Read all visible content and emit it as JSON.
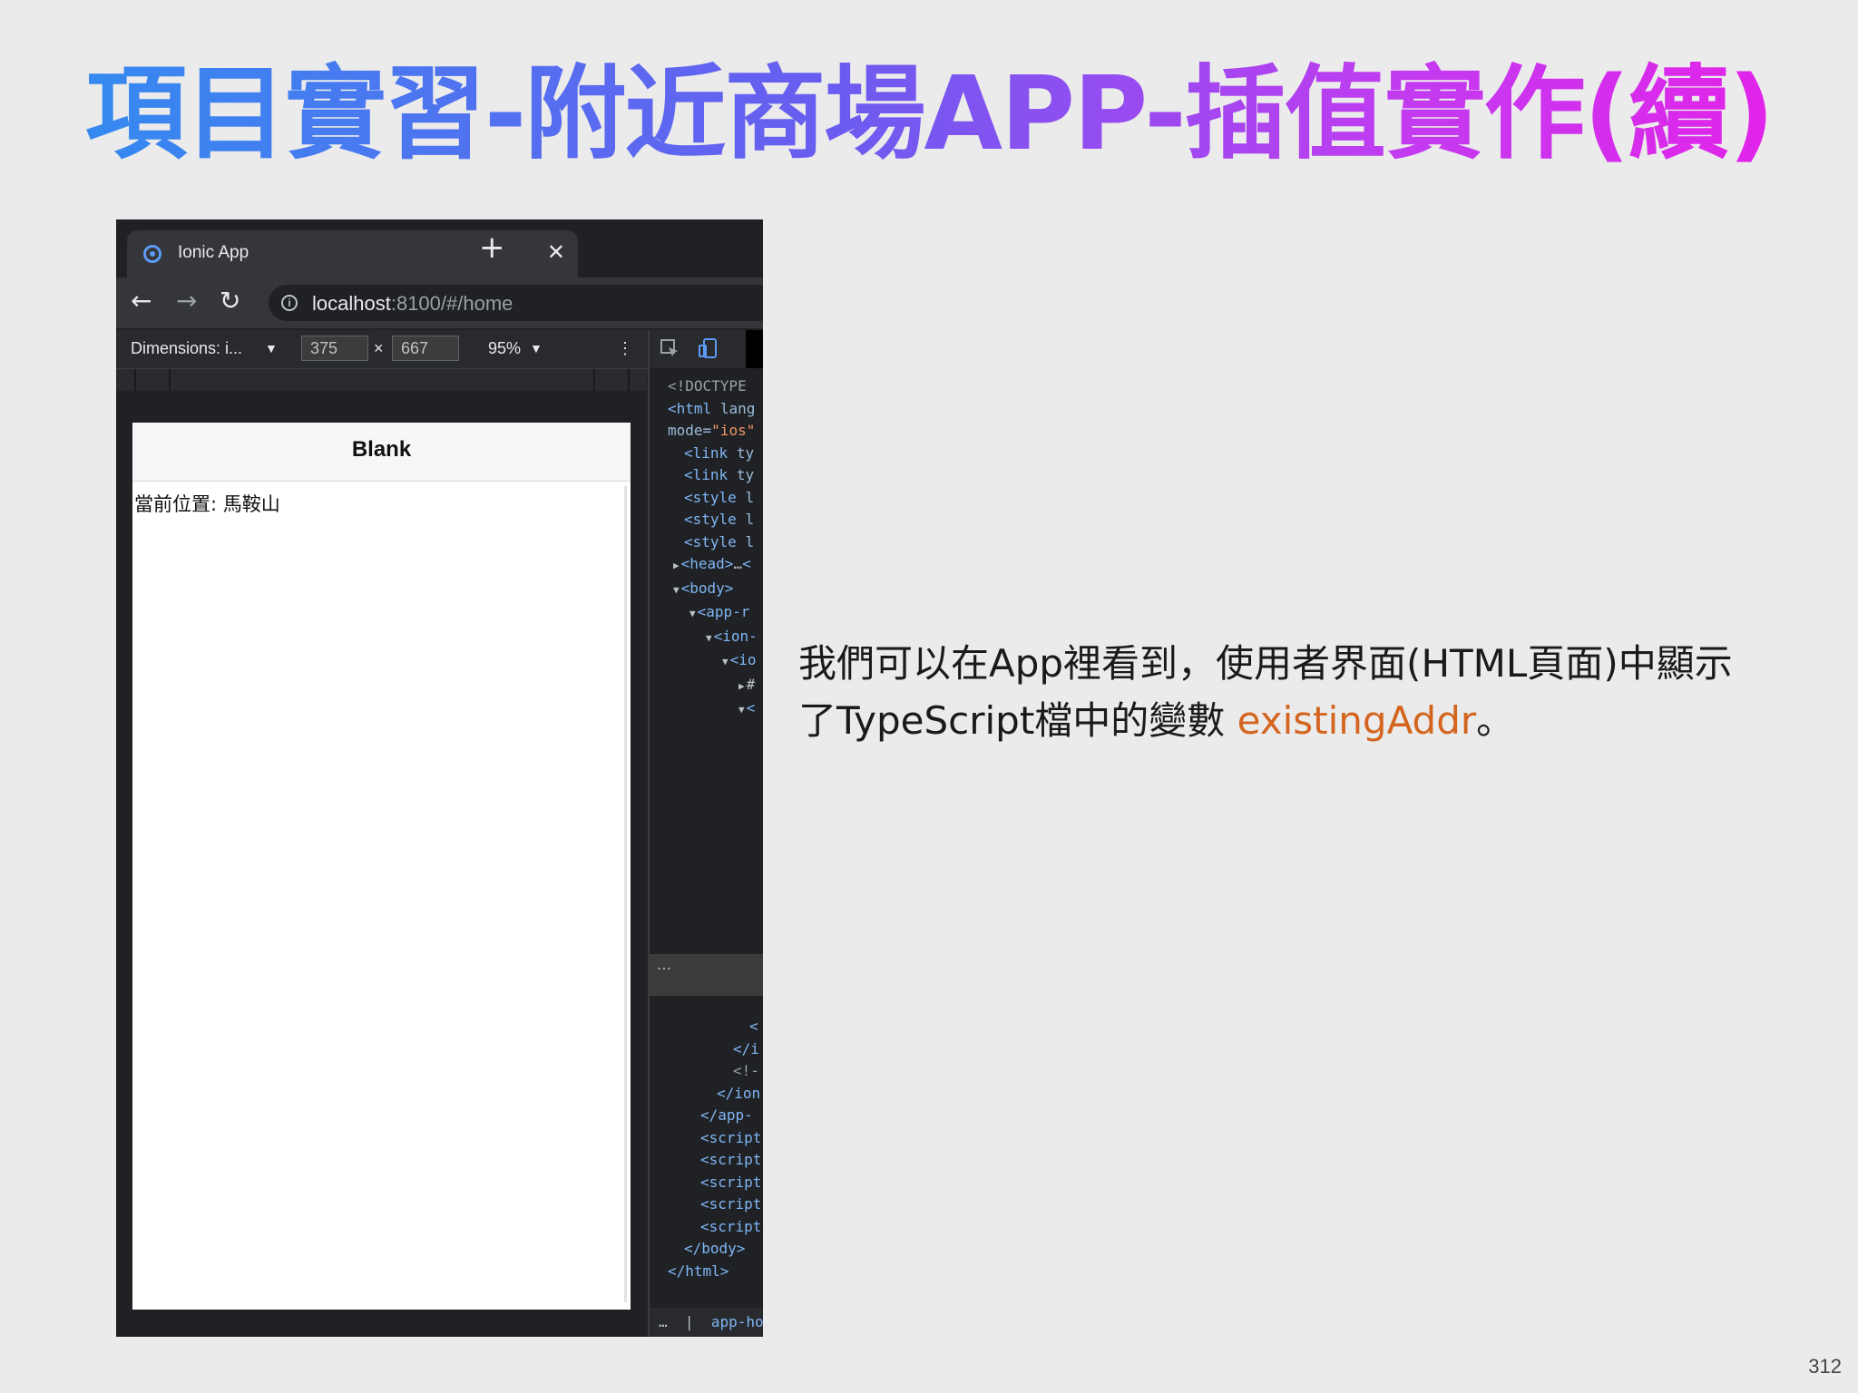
{
  "slide": {
    "title": "項目實習-附近商場APP-插值實作(續)",
    "page_number": "312",
    "caption_before": "我們可以在App裡看到，使用者界面(HTML頁面)中顯示了TypeScript檔中的變數 ",
    "caption_highlight": "existingAddr",
    "caption_after": "。",
    "highlight_color": "#d4651f"
  },
  "browser": {
    "tab_title": "Ionic App",
    "tab_close": "✕",
    "new_tab": "+",
    "url_host": "localhost",
    "url_path": ":8100/#/home",
    "nav": {
      "back": "←",
      "forward": "→",
      "reload": "↻"
    }
  },
  "devbar": {
    "device": "Dimensions: i...",
    "device_arrow": "▼",
    "width": "375",
    "times": "×",
    "height": "667",
    "zoom": "95%",
    "zoom_arrow": "▼",
    "more": "⋮"
  },
  "app": {
    "title": "Blank",
    "content": "當前位置: 馬鞍山"
  },
  "devtools": {
    "lines": [
      {
        "indent": 0,
        "arrow": "",
        "html": "<span class='cmt'>&lt;!DOCTYPE</span>"
      },
      {
        "indent": 0,
        "arrow": "",
        "html": "<span class='tag'>&lt;html</span> <span class='attr'>lang</span>"
      },
      {
        "indent": 0,
        "arrow": "",
        "html": "<span class='attr'>mode=</span><span class='val'>\"ios\"</span>"
      },
      {
        "indent": 1,
        "arrow": "",
        "html": "<span class='tag'>&lt;link</span> <span class='attr'>ty</span>"
      },
      {
        "indent": 1,
        "arrow": "",
        "html": "<span class='tag'>&lt;link</span> <span class='attr'>ty</span>"
      },
      {
        "indent": 1,
        "arrow": "",
        "html": "<span class='tag'>&lt;style</span> <span class='attr'>l</span>"
      },
      {
        "indent": 1,
        "arrow": "",
        "html": "<span class='tag'>&lt;style</span> <span class='attr'>l</span>"
      },
      {
        "indent": 1,
        "arrow": "",
        "html": "<span class='tag'>&lt;style</span> <span class='attr'>l</span>"
      },
      {
        "indent": 1,
        "arrow": "▶",
        "html": "<span class='tag'>&lt;head&gt;</span>…<span class='tag'>&lt;</span>"
      },
      {
        "indent": 1,
        "arrow": "▼",
        "html": "<span class='tag'>&lt;body&gt;</span>"
      },
      {
        "indent": 2,
        "arrow": "▼",
        "html": "<span class='tag'>&lt;app-r</span>"
      },
      {
        "indent": 3,
        "arrow": "▼",
        "html": "<span class='tag'>&lt;ion-</span>"
      },
      {
        "indent": 4,
        "arrow": "▼",
        "html": "<span class='tag'>&lt;io</span>"
      },
      {
        "indent": 5,
        "arrow": "▶",
        "html": "#"
      },
      {
        "indent": 5,
        "arrow": "▼",
        "html": "<span class='tag'>&lt;</span>"
      }
    ],
    "lower_lines": [
      {
        "indent": 5,
        "html": "<span class='tag'>&lt;</span>"
      },
      {
        "indent": 4,
        "html": "<span class='tag'>&lt;/i</span>"
      },
      {
        "indent": 4,
        "html": "<span class='cmt'>&lt;!-</span>"
      },
      {
        "indent": 3,
        "html": "<span class='tag'>&lt;/ion</span>"
      },
      {
        "indent": 2,
        "html": "<span class='tag'>&lt;/app-</span>"
      },
      {
        "indent": 2,
        "html": "<span class='tag'>&lt;script</span>"
      },
      {
        "indent": 2,
        "html": "<span class='tag'>&lt;script</span>"
      },
      {
        "indent": 2,
        "html": "<span class='tag'>&lt;script</span>"
      },
      {
        "indent": 2,
        "html": "<span class='tag'>&lt;script</span>"
      },
      {
        "indent": 2,
        "html": "<span class='tag'>&lt;script</span>"
      },
      {
        "indent": 1,
        "html": "<span class='tag'>&lt;/body&gt;</span>"
      },
      {
        "indent": 0,
        "html": "<span class='tag'>&lt;/html&gt;</span>"
      }
    ],
    "separator": "…",
    "breadcrumb_dots": "…",
    "breadcrumb": "app-ho"
  }
}
